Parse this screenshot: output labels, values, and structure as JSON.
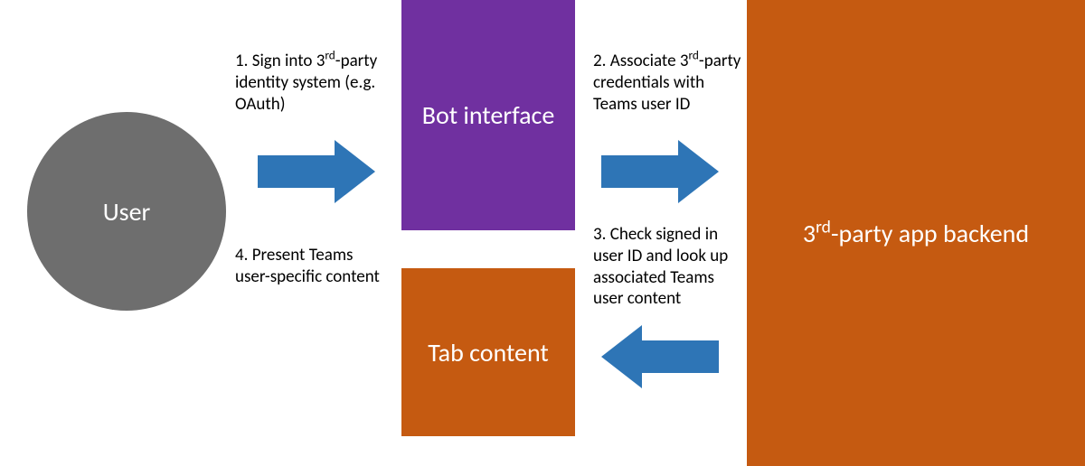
{
  "nodes": {
    "user": {
      "label": "User"
    },
    "bot": {
      "label": "Bot interface"
    },
    "tab": {
      "label": "Tab content"
    },
    "backend": {
      "label_prefix": "3",
      "label_sup": "rd",
      "label_suffix": "-party app backend"
    }
  },
  "steps": {
    "s1": {
      "prefix": "1. Sign into 3",
      "sup": "rd",
      "suffix": "-party identity system (e.g. OAuth)"
    },
    "s2": {
      "prefix": "2. Associate 3",
      "sup": "rd",
      "suffix": "-party credentials with Teams user ID"
    },
    "s3": {
      "text": "3. Check signed in user ID and look up associated Teams user content"
    },
    "s4": {
      "text": "4. Present Teams user-specific content"
    }
  },
  "colors": {
    "user": "#6e6e6e",
    "bot": "#7030a0",
    "tab": "#c55a11",
    "backend": "#c55a11",
    "arrow": "#2e75b6"
  }
}
